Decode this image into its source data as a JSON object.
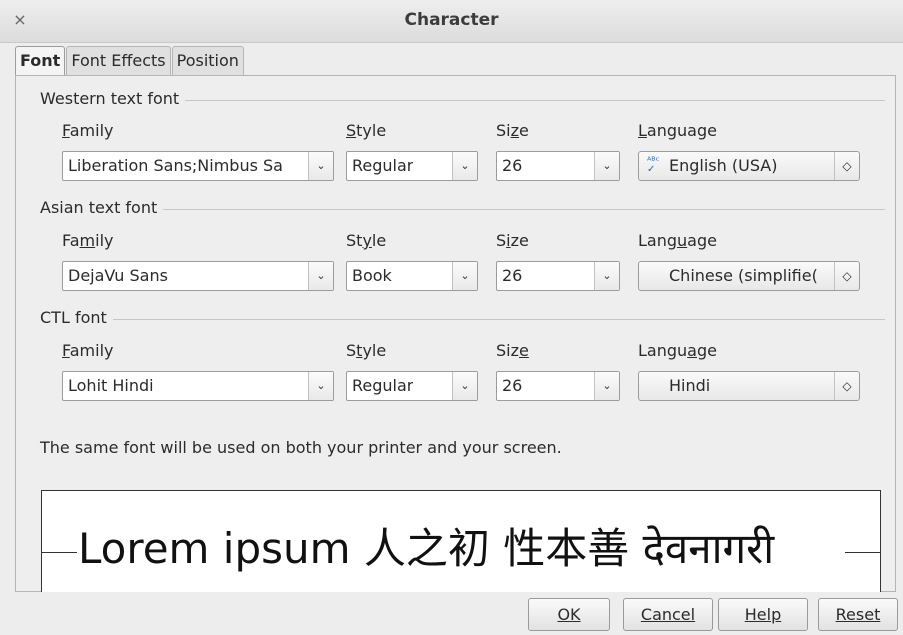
{
  "window": {
    "title": "Character",
    "close_glyph": "×"
  },
  "tabs": [
    {
      "label": "Font",
      "active": true
    },
    {
      "label": "Font Effects",
      "active": false
    },
    {
      "label": "Position",
      "active": false
    }
  ],
  "western": {
    "group_title": "Western text font",
    "family_label": "Family",
    "style_label": "Style",
    "size_label": "Size",
    "language_label": "Language",
    "family_value": "Liberation Sans;Nimbus Sa",
    "style_value": "Regular",
    "size_value": "26",
    "language_value": "English (USA)"
  },
  "asian": {
    "group_title": "Asian text font",
    "family_label": "Family",
    "style_label": "Style",
    "size_label": "Size",
    "language_label": "Language",
    "family_value": "DejaVu Sans",
    "style_value": "Book",
    "size_value": "26",
    "language_value": "Chinese (simplifie("
  },
  "ctl": {
    "group_title": "CTL font",
    "family_label": "Family",
    "style_label": "Style",
    "size_label": "Size",
    "language_label": "Language",
    "family_value": "Lohit Hindi",
    "style_value": "Regular",
    "size_value": "26",
    "language_value": "Hindi"
  },
  "note": "The same font will be used on both your printer and your screen.",
  "preview_text": "Lorem ipsum   人之初 性本善 देवनागरी",
  "buttons": {
    "ok": "OK",
    "cancel": "Cancel",
    "help": "Help",
    "reset": "Reset"
  },
  "icons": {
    "dropdown": "chevron-down-icon",
    "spin": "up-down-spin-icon",
    "spell": "spellcheck-icon"
  }
}
